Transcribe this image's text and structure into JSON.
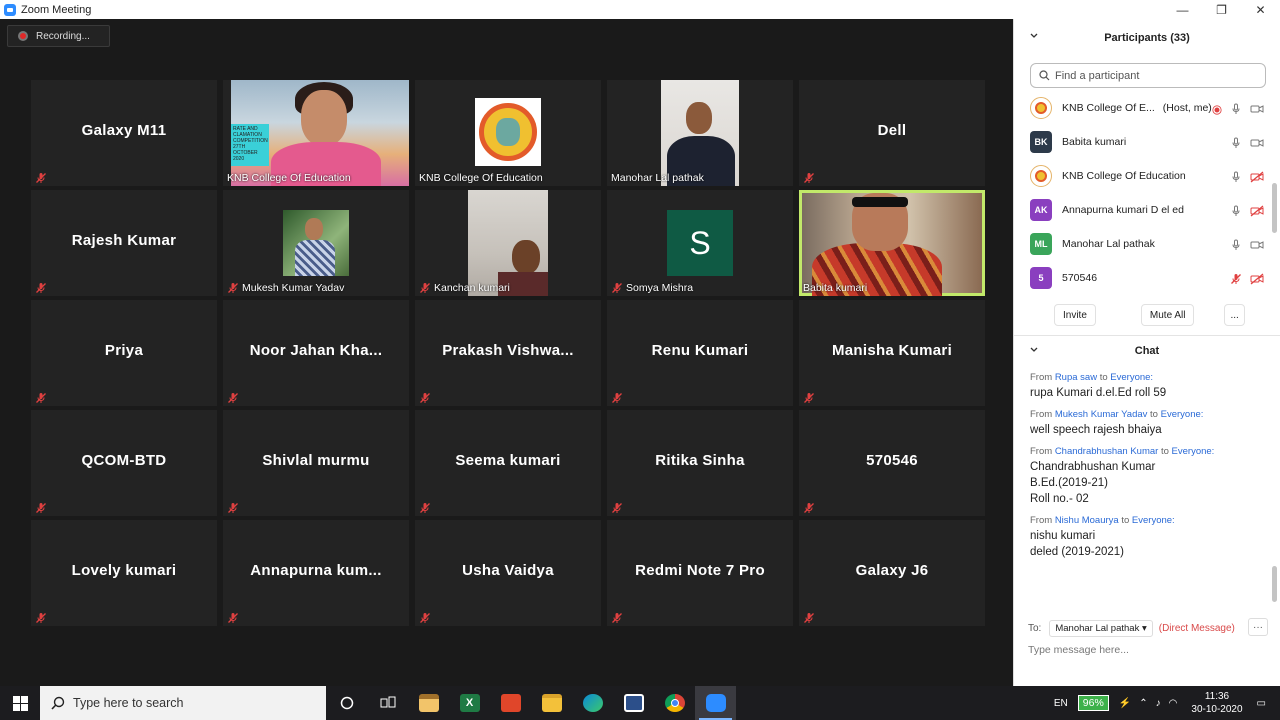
{
  "window": {
    "title": "Zoom Meeting",
    "controls": [
      "—",
      "❐",
      "✕"
    ]
  },
  "meeting": {
    "recording_label": "Recording...",
    "tiles": [
      {
        "name": "Galaxy M11",
        "type": "name"
      },
      {
        "name": "KNB College Of Education",
        "type": "video",
        "video": "knb-person"
      },
      {
        "name": "KNB College Of Education",
        "type": "video",
        "video": "knb-logo"
      },
      {
        "name": "Manohar Lal pathak",
        "type": "video",
        "video": "manohar"
      },
      {
        "name": "Dell",
        "type": "name"
      },
      {
        "name": "Rajesh Kumar",
        "type": "name"
      },
      {
        "name": "Mukesh Kumar Yadav",
        "type": "video",
        "video": "mukesh",
        "muted": true
      },
      {
        "name": "Kanchan kumari",
        "type": "video",
        "video": "kanchan",
        "muted": true
      },
      {
        "name": "Somya Mishra",
        "type": "video",
        "video": "somya",
        "muted": true
      },
      {
        "name": "Babita kumari",
        "type": "video",
        "video": "babita",
        "active": true
      },
      {
        "name": "Priya",
        "type": "name"
      },
      {
        "name": "Noor Jahan Kha...",
        "type": "name"
      },
      {
        "name": "Prakash Vishwa...",
        "type": "name"
      },
      {
        "name": "Renu Kumari",
        "type": "name"
      },
      {
        "name": "Manisha Kumari",
        "type": "name"
      },
      {
        "name": "QCOM-BTD",
        "type": "name"
      },
      {
        "name": "Shivlal murmu",
        "type": "name"
      },
      {
        "name": "Seema kumari",
        "type": "name"
      },
      {
        "name": "Ritika Sinha",
        "type": "name"
      },
      {
        "name": "570546",
        "type": "name"
      },
      {
        "name": "Lovely kumari",
        "type": "name"
      },
      {
        "name": "Annapurna kum...",
        "type": "name"
      },
      {
        "name": "Usha Vaidya",
        "type": "name"
      },
      {
        "name": "Redmi Note 7 Pro",
        "type": "name"
      },
      {
        "name": "Galaxy J6",
        "type": "name"
      }
    ],
    "somya_initial": "S",
    "poster_text": "RATE AND CLAMATION COMPETITION 27TH OCTOBER 2020"
  },
  "participants": {
    "header": "Participants (33)",
    "search_placeholder": "Find a participant",
    "list": [
      {
        "name": "KNB College Of E...",
        "tag": "(Host, me)",
        "avatar": "logo",
        "initials": "",
        "color": "#ffffff",
        "mic": "on",
        "video": "on",
        "recording": true
      },
      {
        "name": "Babita kumari",
        "tag": "",
        "avatar": "initials",
        "initials": "BK",
        "color": "#2d3a4a",
        "mic": "on",
        "video": "on"
      },
      {
        "name": "KNB College Of Education",
        "tag": "",
        "avatar": "logo",
        "initials": "",
        "color": "#ffffff",
        "mic": "on",
        "video": "off"
      },
      {
        "name": "Annapurna kumari D el ed",
        "tag": "",
        "avatar": "initials",
        "initials": "AK",
        "color": "#8a3fbf",
        "mic": "on",
        "video": "off"
      },
      {
        "name": "Manohar Lal pathak",
        "tag": "",
        "avatar": "initials",
        "initials": "ML",
        "color": "#3aa55a",
        "mic": "on",
        "video": "on"
      },
      {
        "name": "570546",
        "tag": "",
        "avatar": "initials",
        "initials": "5",
        "color": "#8a3fbf",
        "mic": "off",
        "video": "off"
      }
    ],
    "buttons": {
      "invite": "Invite",
      "mute_all": "Mute All",
      "more": "..."
    }
  },
  "chat": {
    "header": "Chat",
    "from_label": "From",
    "to_label": "to",
    "messages": [
      {
        "from": "Rupa saw",
        "to": "Everyone:",
        "text": "rupa Kumari d.el.Ed roll 59"
      },
      {
        "from": "Mukesh Kumar Yadav",
        "to": "Everyone:",
        "text": "well speech rajesh bhaiya"
      },
      {
        "from": "Chandrabhushan Kumar",
        "to": "Everyone:",
        "text": "Chandrabhushan Kumar\nB.Ed.(2019-21)\nRoll no.- 02"
      },
      {
        "from": "Nishu Moaurya",
        "to": "Everyone:",
        "text": "nishu kumari\ndeled (2019-2021)"
      }
    ],
    "to_prefix": "To:",
    "recipient": "Manohar Lal pathak",
    "direct_message": "(Direct Message)",
    "more": "···",
    "input_placeholder": "Type message here..."
  },
  "taskbar": {
    "search_placeholder": "Type here to search",
    "language": "EN",
    "battery": "96%",
    "time": "11:36",
    "date": "30-10-2020",
    "apps": [
      "cortana-icon",
      "task-view-icon",
      "store-icon",
      "excel-icon",
      "office-icon",
      "file-explorer-icon",
      "edge-icon",
      "photos-icon",
      "chrome-icon",
      "zoom-icon"
    ]
  }
}
